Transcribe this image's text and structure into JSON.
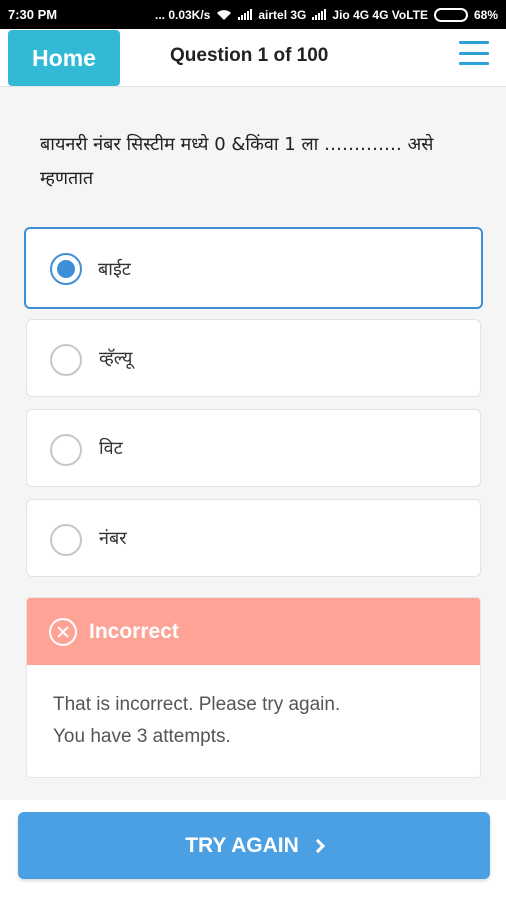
{
  "status_bar": {
    "time": "7:30 PM",
    "speed": "... 0.03K/s",
    "carrier1": "airtel 3G",
    "carrier2": "Jio 4G 4G VoLTE",
    "battery": "68%",
    "battery_level": 0.68
  },
  "header": {
    "home_label": "Home",
    "title": "Question 1 of 100"
  },
  "question": {
    "text": "बायनरी नंबर सिस्टीम मध्ये 0 &किंवा 1 ला …………. असे म्हणतात"
  },
  "options": [
    {
      "label": "बाईट",
      "selected": true
    },
    {
      "label": "व्हॅल्यू",
      "selected": false
    },
    {
      "label": "विट",
      "selected": false
    },
    {
      "label": "नंबर",
      "selected": false
    }
  ],
  "feedback": {
    "title": "Incorrect",
    "line1": "That is incorrect. Please try again.",
    "line2": "You have 3 attempts."
  },
  "action": {
    "label": "TRY AGAIN"
  },
  "colors": {
    "accent": "#31b9d6",
    "selected": "#3f8fd8",
    "error": "#fea395",
    "button": "#4aa0e2"
  }
}
